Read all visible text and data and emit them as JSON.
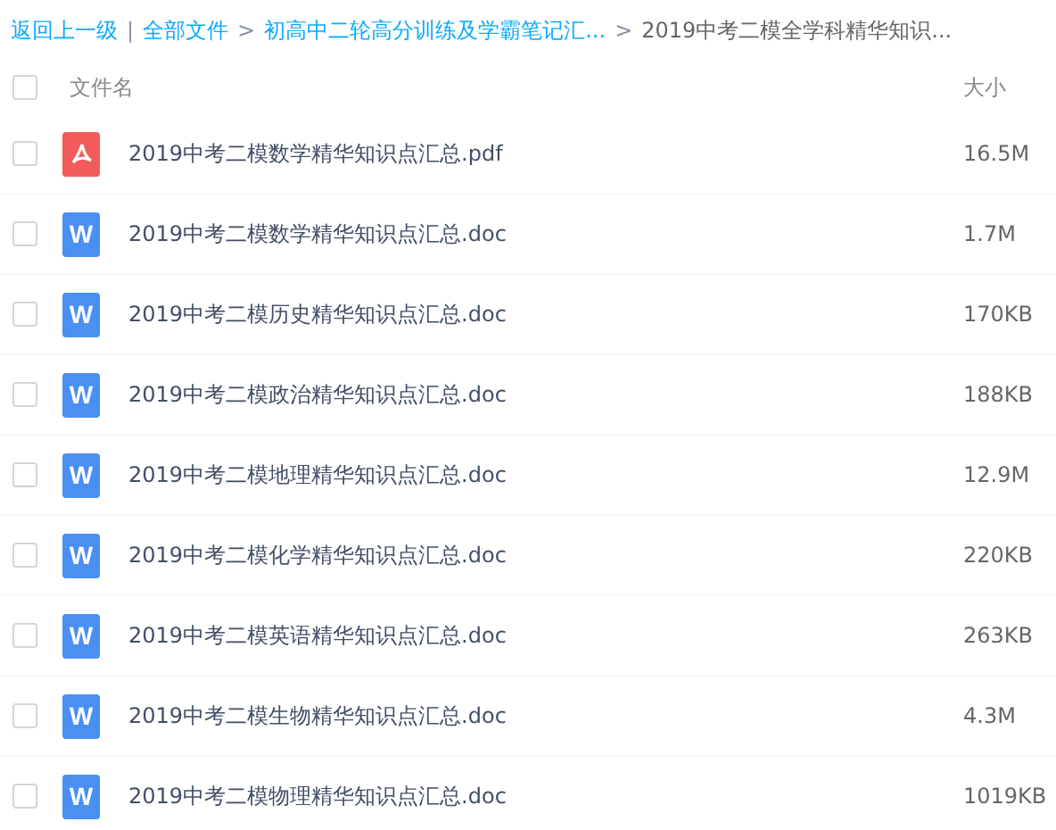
{
  "breadcrumb": [
    {
      "kind": "link",
      "label": "返回上一级"
    },
    {
      "kind": "separator",
      "label": "|"
    },
    {
      "kind": "link",
      "label": "全部文件"
    },
    {
      "kind": "separator",
      "label": ">"
    },
    {
      "kind": "link",
      "label": "初高中二轮高分训练及学霸笔记汇..."
    },
    {
      "kind": "separator",
      "label": ">"
    },
    {
      "kind": "current",
      "label": "2019中考二模全学科精华知识..."
    }
  ],
  "header": {
    "checked": false,
    "name": "文件名",
    "size": "大小"
  },
  "files": [
    {
      "kind": "pdf",
      "checked": false,
      "name": "2019中考二模数学精华知识点汇总.pdf",
      "size": "16.5M"
    },
    {
      "kind": "doc",
      "icon_text": "W",
      "checked": false,
      "name": "2019中考二模数学精华知识点汇总.doc",
      "size": "1.7M"
    },
    {
      "kind": "doc",
      "icon_text": "W",
      "checked": false,
      "name": "2019中考二模历史精华知识点汇总.doc",
      "size": "170KB"
    },
    {
      "kind": "doc",
      "icon_text": "W",
      "checked": false,
      "name": "2019中考二模政治精华知识点汇总.doc",
      "size": "188KB"
    },
    {
      "kind": "doc",
      "icon_text": "W",
      "checked": false,
      "name": "2019中考二模地理精华知识点汇总.doc",
      "size": "12.9M"
    },
    {
      "kind": "doc",
      "icon_text": "W",
      "checked": false,
      "name": "2019中考二模化学精华知识点汇总.doc",
      "size": "220KB"
    },
    {
      "kind": "doc",
      "icon_text": "W",
      "checked": false,
      "name": "2019中考二模英语精华知识点汇总.doc",
      "size": "263KB"
    },
    {
      "kind": "doc",
      "icon_text": "W",
      "checked": false,
      "name": "2019中考二模生物精华知识点汇总.doc",
      "size": "4.3M"
    },
    {
      "kind": "doc",
      "icon_text": "W",
      "checked": false,
      "name": "2019中考二模物理精华知识点汇总.doc",
      "size": "1019KB"
    }
  ]
}
